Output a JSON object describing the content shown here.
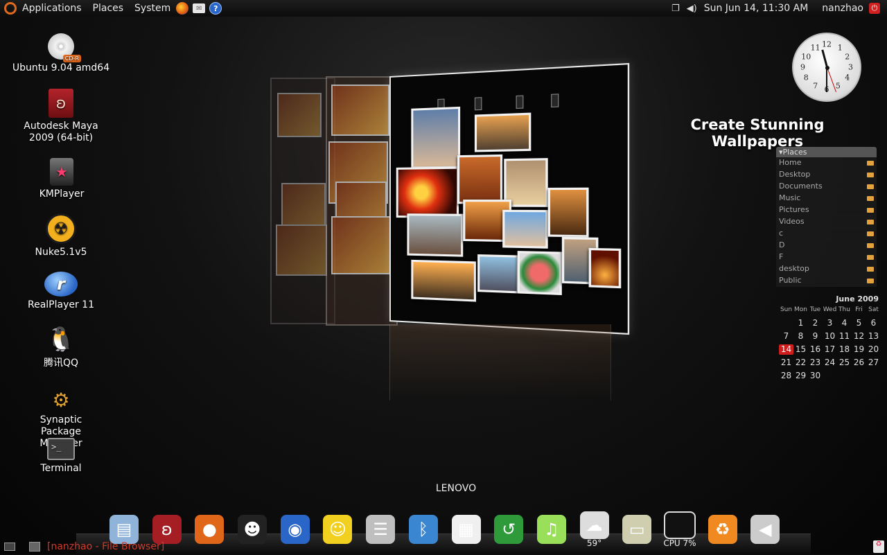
{
  "top_panel": {
    "menus": [
      "Applications",
      "Places",
      "System"
    ],
    "launchers": [
      "firefox-icon",
      "mail-icon",
      "help-icon"
    ],
    "datetime": "Sun Jun 14, 11:30 AM",
    "user": "nanzhao"
  },
  "desktop_icons": [
    {
      "label": "Ubuntu 9.04 amd64",
      "icon": "cd-icon",
      "badge": "CD-R"
    },
    {
      "label": "Autodesk Maya 2009 (64-bit)",
      "icon": "maya-icon"
    },
    {
      "label": "KMPlayer",
      "icon": "kmplayer-icon"
    },
    {
      "label": "Nuke5.1v5",
      "icon": "nuke-icon"
    },
    {
      "label": "RealPlayer 11",
      "icon": "realplayer-icon"
    },
    {
      "label": "腾讯QQ",
      "icon": "qq-penguin-icon"
    },
    {
      "label": "Synaptic Package Manager",
      "icon": "synaptic-icon"
    },
    {
      "label": "Terminal",
      "icon": "terminal-icon"
    }
  ],
  "switcher": {
    "host_label": "LENOVO"
  },
  "widgets": {
    "wallpaper_text": "Create Stunning Wallpapers",
    "places_title": "▾Places",
    "places": [
      "Home",
      "Desktop",
      "Documents",
      "Music",
      "Pictures",
      "Videos",
      "c",
      "D",
      "F",
      "desktop",
      "Public"
    ],
    "calendar": {
      "title": "June 2009",
      "weekdays": [
        "Sun",
        "Mon",
        "Tue",
        "Wed",
        "Thu",
        "Fri",
        "Sat"
      ],
      "today": 14,
      "weeks": [
        [
          "",
          "1",
          "2",
          "3",
          "4",
          "5",
          "6"
        ],
        [
          "7",
          "8",
          "9",
          "10",
          "11",
          "12",
          "13"
        ],
        [
          "14",
          "15",
          "16",
          "17",
          "18",
          "19",
          "20"
        ],
        [
          "21",
          "22",
          "23",
          "24",
          "25",
          "26",
          "27"
        ],
        [
          "28",
          "29",
          "30",
          "",
          "",
          "",
          ""
        ]
      ]
    },
    "clock_numbers": [
      "12",
      "1",
      "2",
      "3",
      "4",
      "5",
      "6",
      "7",
      "8",
      "9",
      "10",
      "11"
    ]
  },
  "dock": [
    {
      "name": "file-manager-icon",
      "glyph": "▤",
      "color": "#8fb3d9"
    },
    {
      "name": "maya-dock-icon",
      "glyph": "ʚ",
      "color": "#a41e24"
    },
    {
      "name": "firefox-dock-icon",
      "glyph": "●",
      "color": "#e0661a"
    },
    {
      "name": "qq-dock-icon",
      "glyph": "☻",
      "color": "#222222"
    },
    {
      "name": "web-browser-icon",
      "glyph": "◉",
      "color": "#2a66c7"
    },
    {
      "name": "emoticon-icon",
      "glyph": "☺",
      "color": "#f2d020"
    },
    {
      "name": "storage-drive-icon",
      "glyph": "☰",
      "color": "#bfbfbf"
    },
    {
      "name": "bluetooth-icon",
      "glyph": "ᛒ",
      "color": "#3a86d0"
    },
    {
      "name": "calendar-app-icon",
      "glyph": "▦",
      "color": "#f0f0f0"
    },
    {
      "name": "time-machine-icon",
      "glyph": "↺",
      "color": "#2e9a3a"
    },
    {
      "name": "music-player-icon",
      "glyph": "♫",
      "color": "#9adf5a"
    },
    {
      "name": "weather-icon",
      "glyph": "☁",
      "color": "#dddddd",
      "sub": "59°"
    },
    {
      "name": "folder-icon",
      "glyph": "▭",
      "color": "#cfcfb0"
    },
    {
      "name": "system-monitor-icon",
      "glyph": "",
      "color": "#111111",
      "sub": "CPU 7%"
    },
    {
      "name": "recycle-icon",
      "glyph": "♻",
      "color": "#f08a20"
    },
    {
      "name": "volume-icon",
      "glyph": "◀",
      "color": "#cccccc"
    }
  ],
  "bottom_panel": {
    "task": "[nanzhao - File Browser]"
  }
}
